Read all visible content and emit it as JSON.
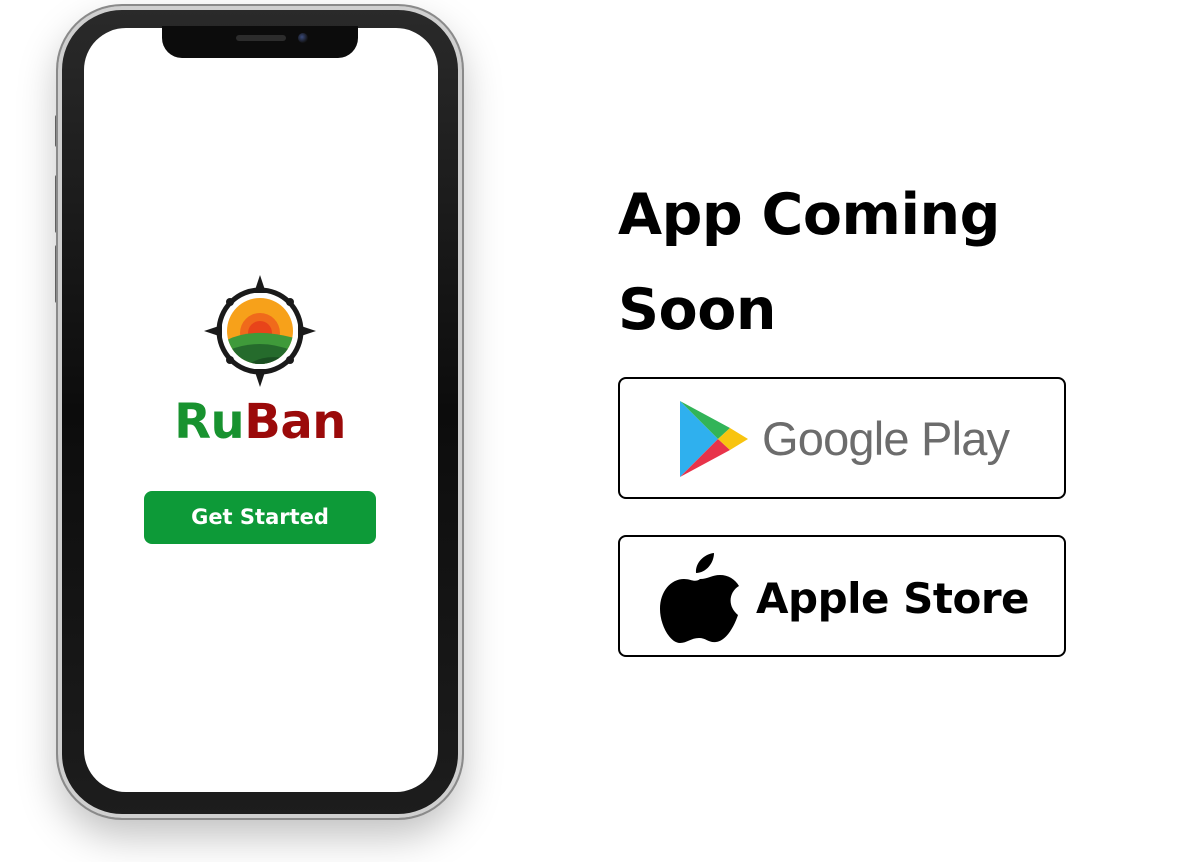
{
  "phone": {
    "brand": {
      "part1": "Ru",
      "part2": "Ban"
    },
    "cta_label": "Get Started",
    "logo_icon": "compass-sunrise-logo-icon"
  },
  "promo": {
    "headline_line1": "App Coming",
    "headline_line2": "Soon"
  },
  "stores": {
    "google": {
      "label": "Google Play",
      "icon": "google-play-icon"
    },
    "apple": {
      "label": "Apple Store",
      "icon": "apple-icon"
    }
  },
  "colors": {
    "brand_green": "#18922f",
    "brand_red": "#9b0a0a",
    "cta_green": "#0d9a38"
  }
}
